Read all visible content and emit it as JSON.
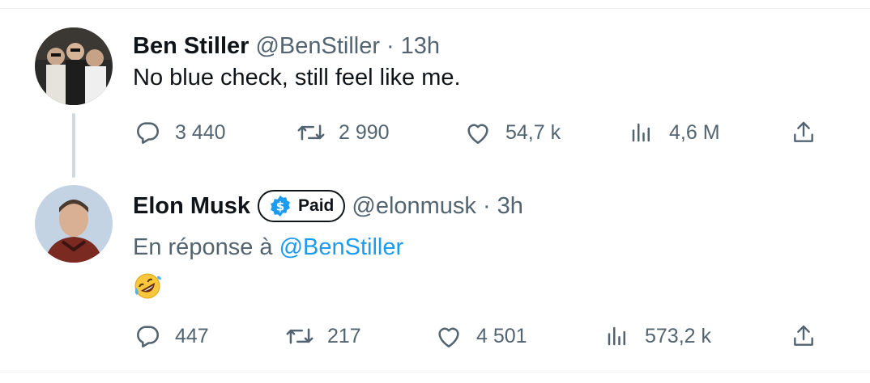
{
  "tweets": [
    {
      "name": "Ben Stiller",
      "handle": "@BenStiller",
      "separator": "·",
      "time": "13h",
      "text": "No blue check, still feel like me.",
      "stats": {
        "replies": "3 440",
        "retweets": "2 990",
        "likes": "54,7 k",
        "views": "4,6 M"
      }
    },
    {
      "name": "Elon Musk",
      "badge": "Paid",
      "handle": "@elonmusk",
      "separator": "·",
      "time": "3h",
      "reply_prefix": "En réponse à",
      "reply_to": "@BenStiller",
      "emoji": "rolling-on-floor-laughing",
      "stats": {
        "replies": "447",
        "retweets": "217",
        "likes": "4 501",
        "views": "573,2 k"
      }
    }
  ],
  "colors": {
    "text": "#0f1419",
    "secondary": "#536471",
    "link": "#1d9bf0",
    "badge_blue": "#1d9bf0"
  }
}
